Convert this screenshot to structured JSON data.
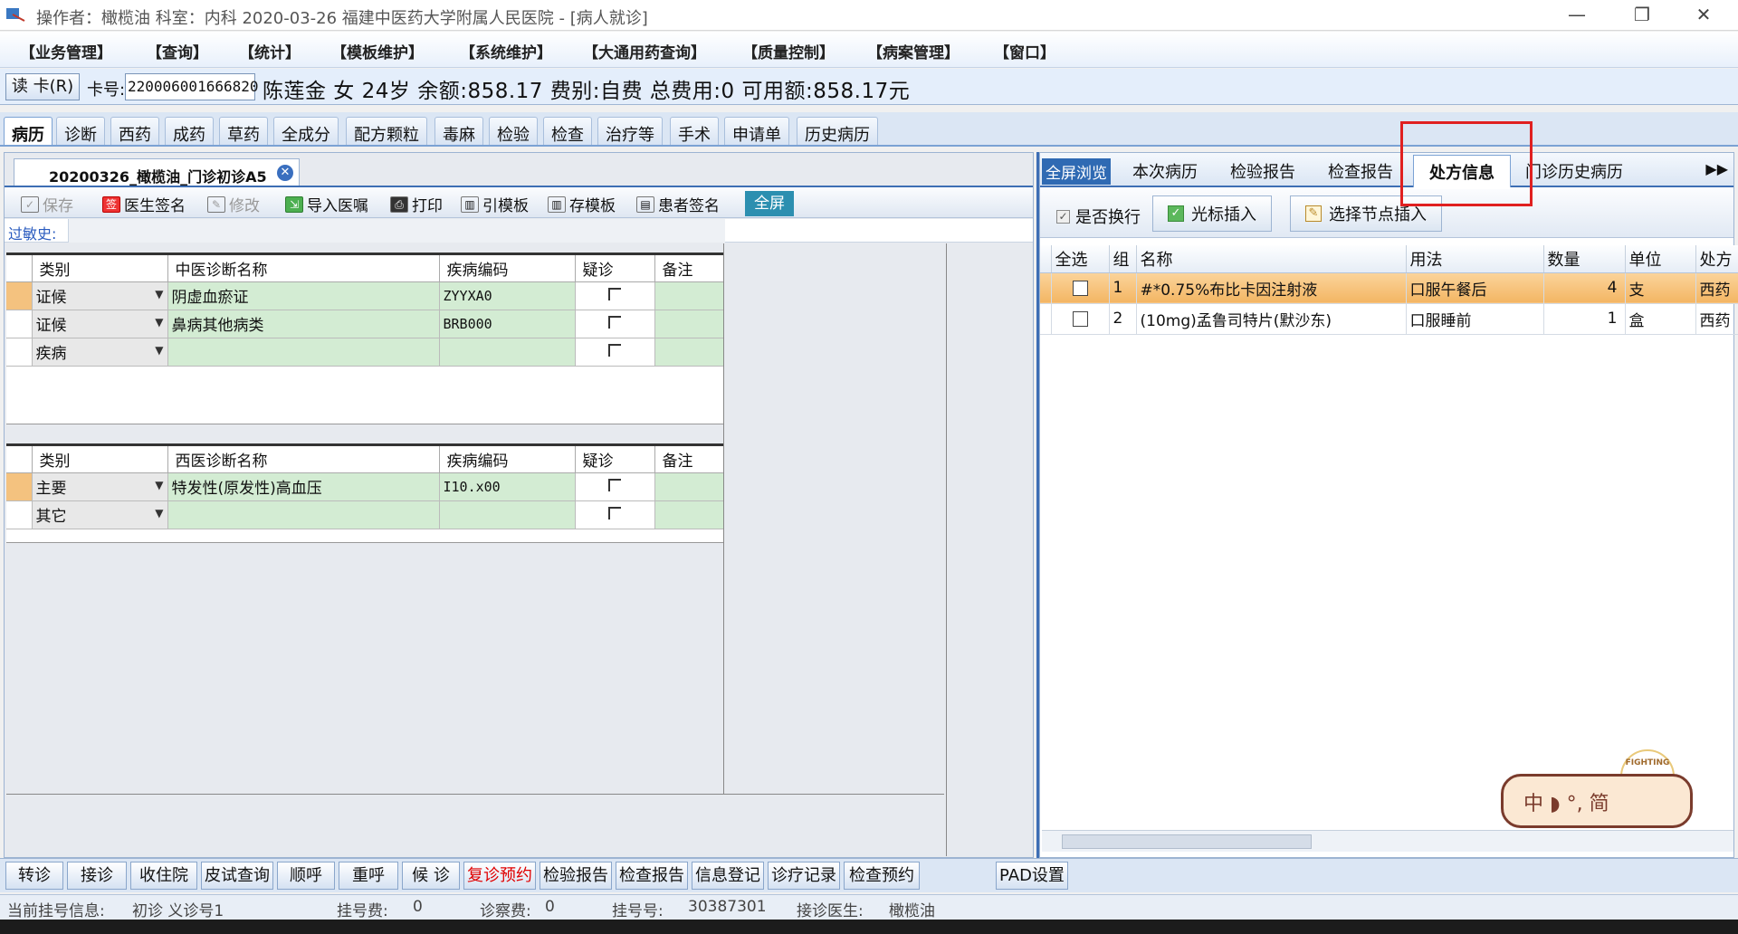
{
  "window": {
    "title": "操作者：橄榄油  科室：内科  2020-03-26  福建中医药大学附属人民医院 - [病人就诊]",
    "minimize": "—",
    "restore": "❐",
    "close": "✕"
  },
  "menu": [
    "【业务管理】",
    "【查询】",
    "【统计】",
    "【模板维护】",
    "【系统维护】",
    "【大通用药查询】",
    "【质量控制】",
    "【病案管理】",
    "【窗口】"
  ],
  "patient": {
    "read_card": "读 卡(R)",
    "card_label": "卡号:",
    "card_no": "220006001666820",
    "info": "陈莲金 女 24岁 余额:858.17 费别:自费 总费用:0 可用额:858.17元"
  },
  "main_tabs": [
    "病历",
    "诊断",
    "西药",
    "成药",
    "草药",
    "全成分",
    "配方颗粒",
    "毒麻",
    "检验",
    "检查",
    "治疗等",
    "手术",
    "申请单",
    "历史病历"
  ],
  "record": {
    "tab_title": "20200326_橄榄油_门诊初诊A5",
    "close": "✕",
    "toolbar": {
      "save": "保存",
      "doctor_sign": "医生签名",
      "modify": "修改",
      "import": "导入医嘱",
      "print": "打印",
      "ref_template": "引模板",
      "save_template": "存模板",
      "patient_sign": "患者签名",
      "fullscreen": "全屏"
    },
    "allergy_label": "过敏史:",
    "tcm_headers": [
      "类别",
      "中医诊断名称",
      "疾病编码",
      "疑诊",
      "备注"
    ],
    "tcm_rows": [
      {
        "type": "证候",
        "name": "阴虚血瘀证",
        "code": "ZYYXA0"
      },
      {
        "type": "证候",
        "name": "鼻病其他病类",
        "code": "BRB000"
      },
      {
        "type": "疾病",
        "name": "",
        "code": ""
      }
    ],
    "wm_headers": [
      "类别",
      "西医诊断名称",
      "疾病编码",
      "疑诊",
      "备注"
    ],
    "wm_rows": [
      {
        "type": "主要",
        "name": "特发性(原发性)高血压",
        "code": "I10.x00"
      },
      {
        "type": "其它",
        "name": "",
        "code": ""
      }
    ]
  },
  "right": {
    "tabs": {
      "browse": "全屏浏览",
      "current": "本次病历",
      "lab": "检验报告",
      "exam": "检查报告",
      "rx": "处方信息",
      "history": "门诊历史病历",
      "more": "▶▶"
    },
    "wrap_label": "是否换行",
    "cursor_insert": "光标插入",
    "node_insert": "选择节点插入",
    "headers": [
      "全选",
      "组",
      "名称",
      "用法",
      "数量",
      "单位",
      "处方"
    ],
    "rows": [
      {
        "group": "1",
        "name": "#*0.75%布比卡因注射液",
        "usage": "口服午餐后",
        "qty": "4",
        "unit": "支",
        "rx": "西药"
      },
      {
        "group": "2",
        "name": "(10mg)孟鲁司特片(默沙东)",
        "usage": "口服睡前",
        "qty": "1",
        "unit": "盒",
        "rx": "西药"
      }
    ]
  },
  "ime": {
    "text": "中 ◗ °, 简",
    "badge": "FIGHTING"
  },
  "bottom_buttons": [
    "转诊",
    "接诊",
    "收住院",
    "皮试查询",
    "顺呼",
    "重呼",
    "候 诊",
    "复诊预约",
    "检验报告",
    "检查报告",
    "信息登记",
    "诊疗记录",
    "检查预约",
    "PAD设置"
  ],
  "status": {
    "reg_info_label": "当前挂号信息:",
    "reg_info": "初诊 义诊号1",
    "reg_fee_label": "挂号费:",
    "reg_fee": "0",
    "diag_fee_label": "诊察费:",
    "diag_fee": "0",
    "reg_no_label": "挂号号:",
    "reg_no": "30387301",
    "doctor_label": "接诊医生:",
    "doctor": "橄榄油"
  },
  "colors": {
    "accent": "#3d6eb4",
    "selected_row": "#f3b563",
    "diag_cell": "#d3ecd3",
    "highlight_box": "#e02020"
  }
}
